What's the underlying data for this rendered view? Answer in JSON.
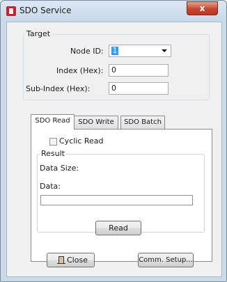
{
  "window": {
    "title": "SDO Service",
    "close_glyph": "x",
    "icon": "app-icon"
  },
  "target": {
    "legend": "Target",
    "node_id_label": "Node ID:",
    "node_id_value": "1",
    "index_label": "Index (Hex):",
    "index_value": "0",
    "subindex_label": "Sub-Index (Hex):",
    "subindex_value": "0"
  },
  "tabs": [
    {
      "label": "SDO Read",
      "active": true
    },
    {
      "label": "SDO Write",
      "active": false
    },
    {
      "label": "SDO Batch",
      "active": false
    }
  ],
  "read_panel": {
    "cyclic_label": "Cyclic Read",
    "cyclic_checked": false,
    "result_legend": "Result",
    "data_size_label": "Data Size:",
    "data_label": "Data:",
    "data_value": "",
    "read_button": "Read"
  },
  "footer": {
    "close_button": "Close",
    "close_icon": "door-exit-icon",
    "comm_setup_button": "Comm. Setup..."
  }
}
